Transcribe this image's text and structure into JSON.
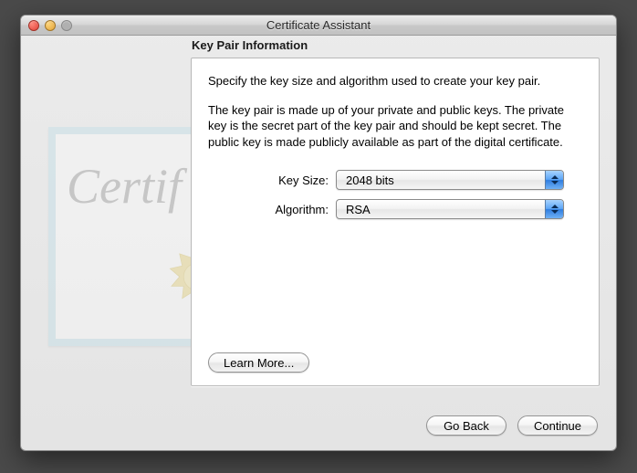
{
  "window": {
    "title": "Certificate Assistant"
  },
  "panel": {
    "heading": "Key Pair Information",
    "intro": "Specify the key size and algorithm used to create your key pair.",
    "desc": "The key pair is made up of your private and public keys. The private key is the secret part of the key pair and should be kept secret. The public key is made publicly available as part of the digital certificate."
  },
  "form": {
    "keySize": {
      "label": "Key Size:",
      "value": "2048 bits"
    },
    "algorithm": {
      "label": "Algorithm:",
      "value": "RSA"
    }
  },
  "buttons": {
    "learnMore": "Learn More...",
    "goBack": "Go Back",
    "continue": "Continue"
  },
  "decoration": {
    "scriptText": "Certif"
  }
}
